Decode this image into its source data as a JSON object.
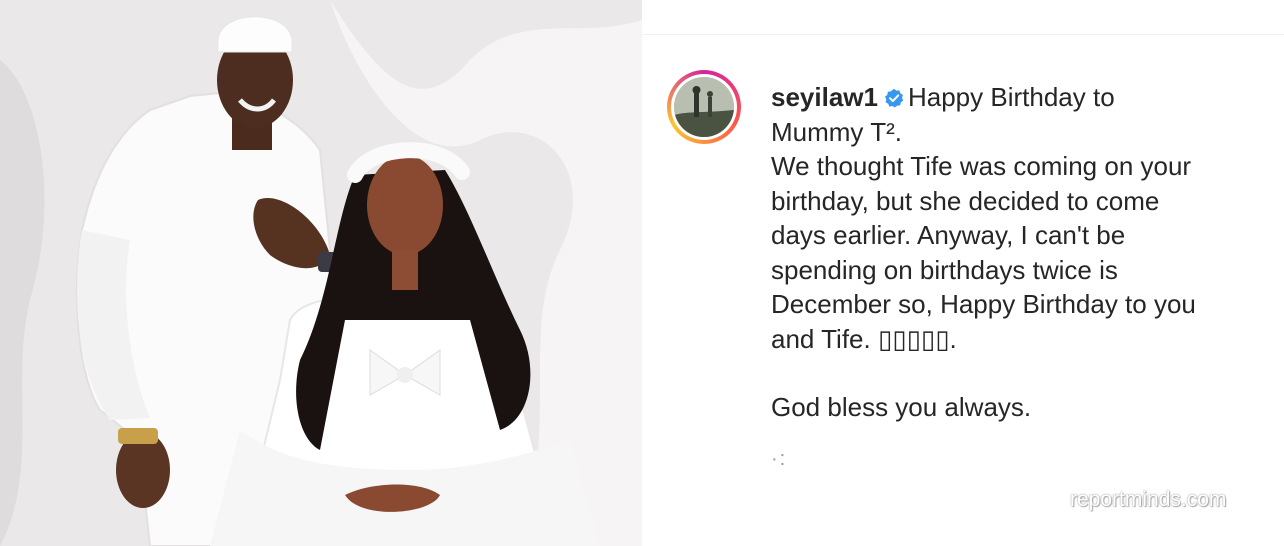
{
  "post": {
    "username": "seyilaw1",
    "caption_line1": "Happy Birthday to",
    "caption_line2": "Mummy T².",
    "caption_body": [
      "We thought Tife was coming on your",
      "birthday, but she decided to come",
      "days earlier. Anyway, I can't be",
      "spending on birthdays twice is",
      "December so, Happy Birthday to you",
      "and Tife. ▯▯▯▯▯."
    ],
    "caption_closing": "God bless you always."
  },
  "watermark": "reportminds.com",
  "icons": {
    "verified": "verified-badge-icon",
    "avatar": "profile-avatar"
  },
  "colors": {
    "text": "#262626",
    "verified": "#3897f0"
  }
}
